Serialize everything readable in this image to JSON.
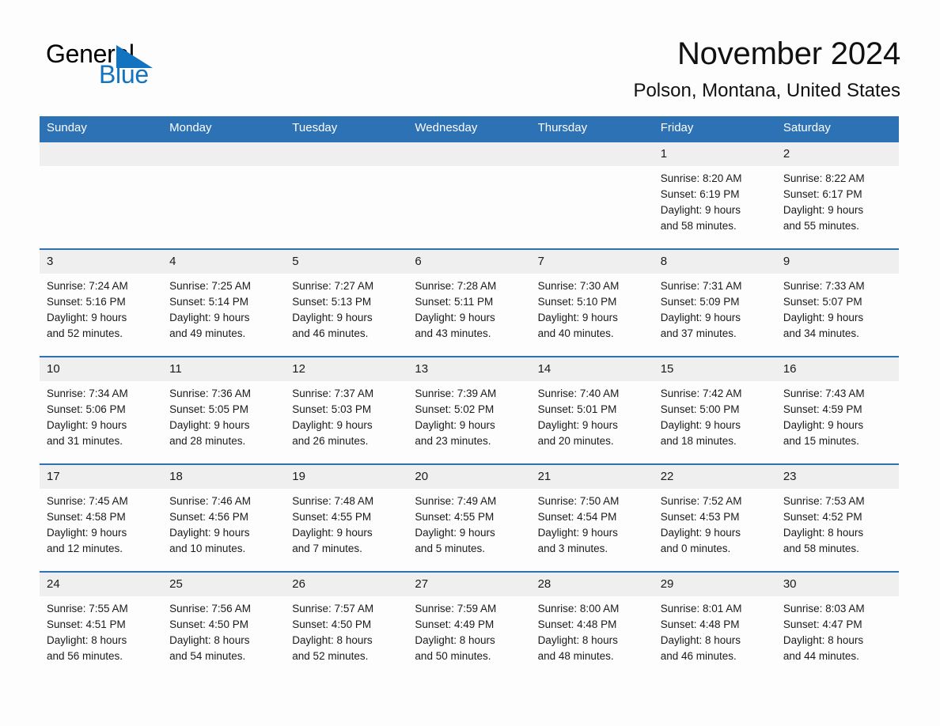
{
  "logo": {
    "word1": "General",
    "word2": "Blue",
    "triangle_color": "#1273c0"
  },
  "header": {
    "month_title": "November 2024",
    "location": "Polson, Montana, United States"
  },
  "colors": {
    "header_blue": "#2d72b5",
    "daynum_band": "#efefef",
    "page_background": "#fdfdfd",
    "text": "#1a1a1a"
  },
  "weekdays": [
    "Sunday",
    "Monday",
    "Tuesday",
    "Wednesday",
    "Thursday",
    "Friday",
    "Saturday"
  ],
  "weeks": [
    [
      {
        "day": "",
        "sunrise": "",
        "sunset": "",
        "daylight_line1": "",
        "daylight_line2": ""
      },
      {
        "day": "",
        "sunrise": "",
        "sunset": "",
        "daylight_line1": "",
        "daylight_line2": ""
      },
      {
        "day": "",
        "sunrise": "",
        "sunset": "",
        "daylight_line1": "",
        "daylight_line2": ""
      },
      {
        "day": "",
        "sunrise": "",
        "sunset": "",
        "daylight_line1": "",
        "daylight_line2": ""
      },
      {
        "day": "",
        "sunrise": "",
        "sunset": "",
        "daylight_line1": "",
        "daylight_line2": ""
      },
      {
        "day": "1",
        "sunrise": "Sunrise: 8:20 AM",
        "sunset": "Sunset: 6:19 PM",
        "daylight_line1": "Daylight: 9 hours",
        "daylight_line2": "and 58 minutes."
      },
      {
        "day": "2",
        "sunrise": "Sunrise: 8:22 AM",
        "sunset": "Sunset: 6:17 PM",
        "daylight_line1": "Daylight: 9 hours",
        "daylight_line2": "and 55 minutes."
      }
    ],
    [
      {
        "day": "3",
        "sunrise": "Sunrise: 7:24 AM",
        "sunset": "Sunset: 5:16 PM",
        "daylight_line1": "Daylight: 9 hours",
        "daylight_line2": "and 52 minutes."
      },
      {
        "day": "4",
        "sunrise": "Sunrise: 7:25 AM",
        "sunset": "Sunset: 5:14 PM",
        "daylight_line1": "Daylight: 9 hours",
        "daylight_line2": "and 49 minutes."
      },
      {
        "day": "5",
        "sunrise": "Sunrise: 7:27 AM",
        "sunset": "Sunset: 5:13 PM",
        "daylight_line1": "Daylight: 9 hours",
        "daylight_line2": "and 46 minutes."
      },
      {
        "day": "6",
        "sunrise": "Sunrise: 7:28 AM",
        "sunset": "Sunset: 5:11 PM",
        "daylight_line1": "Daylight: 9 hours",
        "daylight_line2": "and 43 minutes."
      },
      {
        "day": "7",
        "sunrise": "Sunrise: 7:30 AM",
        "sunset": "Sunset: 5:10 PM",
        "daylight_line1": "Daylight: 9 hours",
        "daylight_line2": "and 40 minutes."
      },
      {
        "day": "8",
        "sunrise": "Sunrise: 7:31 AM",
        "sunset": "Sunset: 5:09 PM",
        "daylight_line1": "Daylight: 9 hours",
        "daylight_line2": "and 37 minutes."
      },
      {
        "day": "9",
        "sunrise": "Sunrise: 7:33 AM",
        "sunset": "Sunset: 5:07 PM",
        "daylight_line1": "Daylight: 9 hours",
        "daylight_line2": "and 34 minutes."
      }
    ],
    [
      {
        "day": "10",
        "sunrise": "Sunrise: 7:34 AM",
        "sunset": "Sunset: 5:06 PM",
        "daylight_line1": "Daylight: 9 hours",
        "daylight_line2": "and 31 minutes."
      },
      {
        "day": "11",
        "sunrise": "Sunrise: 7:36 AM",
        "sunset": "Sunset: 5:05 PM",
        "daylight_line1": "Daylight: 9 hours",
        "daylight_line2": "and 28 minutes."
      },
      {
        "day": "12",
        "sunrise": "Sunrise: 7:37 AM",
        "sunset": "Sunset: 5:03 PM",
        "daylight_line1": "Daylight: 9 hours",
        "daylight_line2": "and 26 minutes."
      },
      {
        "day": "13",
        "sunrise": "Sunrise: 7:39 AM",
        "sunset": "Sunset: 5:02 PM",
        "daylight_line1": "Daylight: 9 hours",
        "daylight_line2": "and 23 minutes."
      },
      {
        "day": "14",
        "sunrise": "Sunrise: 7:40 AM",
        "sunset": "Sunset: 5:01 PM",
        "daylight_line1": "Daylight: 9 hours",
        "daylight_line2": "and 20 minutes."
      },
      {
        "day": "15",
        "sunrise": "Sunrise: 7:42 AM",
        "sunset": "Sunset: 5:00 PM",
        "daylight_line1": "Daylight: 9 hours",
        "daylight_line2": "and 18 minutes."
      },
      {
        "day": "16",
        "sunrise": "Sunrise: 7:43 AM",
        "sunset": "Sunset: 4:59 PM",
        "daylight_line1": "Daylight: 9 hours",
        "daylight_line2": "and 15 minutes."
      }
    ],
    [
      {
        "day": "17",
        "sunrise": "Sunrise: 7:45 AM",
        "sunset": "Sunset: 4:58 PM",
        "daylight_line1": "Daylight: 9 hours",
        "daylight_line2": "and 12 minutes."
      },
      {
        "day": "18",
        "sunrise": "Sunrise: 7:46 AM",
        "sunset": "Sunset: 4:56 PM",
        "daylight_line1": "Daylight: 9 hours",
        "daylight_line2": "and 10 minutes."
      },
      {
        "day": "19",
        "sunrise": "Sunrise: 7:48 AM",
        "sunset": "Sunset: 4:55 PM",
        "daylight_line1": "Daylight: 9 hours",
        "daylight_line2": "and 7 minutes."
      },
      {
        "day": "20",
        "sunrise": "Sunrise: 7:49 AM",
        "sunset": "Sunset: 4:55 PM",
        "daylight_line1": "Daylight: 9 hours",
        "daylight_line2": "and 5 minutes."
      },
      {
        "day": "21",
        "sunrise": "Sunrise: 7:50 AM",
        "sunset": "Sunset: 4:54 PM",
        "daylight_line1": "Daylight: 9 hours",
        "daylight_line2": "and 3 minutes."
      },
      {
        "day": "22",
        "sunrise": "Sunrise: 7:52 AM",
        "sunset": "Sunset: 4:53 PM",
        "daylight_line1": "Daylight: 9 hours",
        "daylight_line2": "and 0 minutes."
      },
      {
        "day": "23",
        "sunrise": "Sunrise: 7:53 AM",
        "sunset": "Sunset: 4:52 PM",
        "daylight_line1": "Daylight: 8 hours",
        "daylight_line2": "and 58 minutes."
      }
    ],
    [
      {
        "day": "24",
        "sunrise": "Sunrise: 7:55 AM",
        "sunset": "Sunset: 4:51 PM",
        "daylight_line1": "Daylight: 8 hours",
        "daylight_line2": "and 56 minutes."
      },
      {
        "day": "25",
        "sunrise": "Sunrise: 7:56 AM",
        "sunset": "Sunset: 4:50 PM",
        "daylight_line1": "Daylight: 8 hours",
        "daylight_line2": "and 54 minutes."
      },
      {
        "day": "26",
        "sunrise": "Sunrise: 7:57 AM",
        "sunset": "Sunset: 4:50 PM",
        "daylight_line1": "Daylight: 8 hours",
        "daylight_line2": "and 52 minutes."
      },
      {
        "day": "27",
        "sunrise": "Sunrise: 7:59 AM",
        "sunset": "Sunset: 4:49 PM",
        "daylight_line1": "Daylight: 8 hours",
        "daylight_line2": "and 50 minutes."
      },
      {
        "day": "28",
        "sunrise": "Sunrise: 8:00 AM",
        "sunset": "Sunset: 4:48 PM",
        "daylight_line1": "Daylight: 8 hours",
        "daylight_line2": "and 48 minutes."
      },
      {
        "day": "29",
        "sunrise": "Sunrise: 8:01 AM",
        "sunset": "Sunset: 4:48 PM",
        "daylight_line1": "Daylight: 8 hours",
        "daylight_line2": "and 46 minutes."
      },
      {
        "day": "30",
        "sunrise": "Sunrise: 8:03 AM",
        "sunset": "Sunset: 4:47 PM",
        "daylight_line1": "Daylight: 8 hours",
        "daylight_line2": "and 44 minutes."
      }
    ]
  ]
}
